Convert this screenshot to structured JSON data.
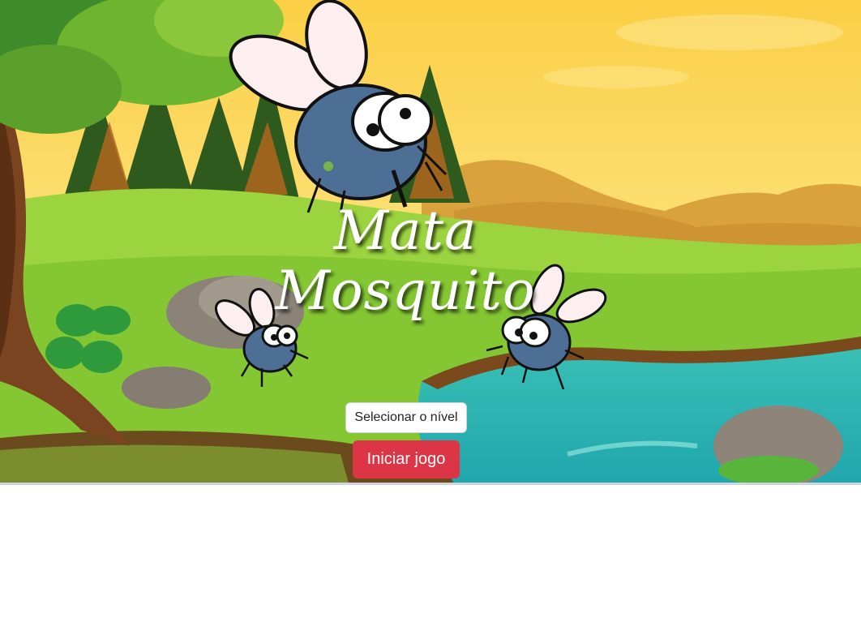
{
  "game": {
    "title_line1": "Mata",
    "title_line2": "Mosquito"
  },
  "controls": {
    "level_select_label": "Selecionar o nível",
    "start_button_label": "Iniciar jogo"
  },
  "colors": {
    "start_button": "#dc3545",
    "sky_top": "#fbd24a",
    "grass": "#8ccf3a",
    "water": "#2fb7b2"
  },
  "icons": [
    "mosquito-icon",
    "mosquito-icon",
    "mosquito-icon"
  ]
}
